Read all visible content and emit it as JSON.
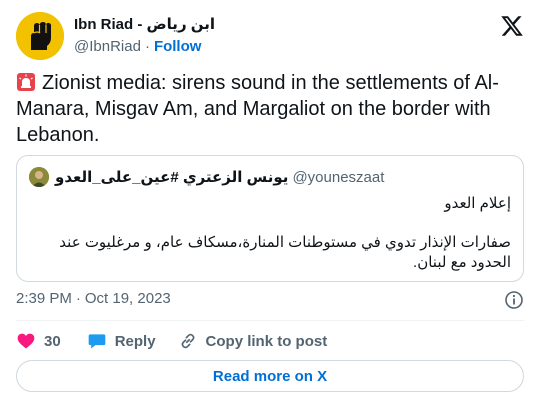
{
  "author": {
    "name": "Ibn Riad - ابن رياض",
    "handle": "@IbnRiad",
    "separator": "·",
    "follow_label": "Follow"
  },
  "tweet": {
    "icon": "rotating-light-icon",
    "text": "Zionist media: sirens sound in the settlements of Al-Manara, Misgav Am, and Margaliot on the border with Lebanon."
  },
  "quote": {
    "name": "يونس الزعتري #عين_على_العدو",
    "handle": "@youneszaat",
    "line1": "إعلام العدو",
    "body": "صفارات الإنذار تدوي في مستوطنات المنارة،مسكاف عام، و مرغليوت عند الحدود مع لبنان."
  },
  "meta": {
    "time": "2:39 PM",
    "separator": "·",
    "date": "Oct 19, 2023"
  },
  "actions": {
    "like_count": "30",
    "reply_label": "Reply",
    "copy_label": "Copy link to post"
  },
  "read_more_label": "Read more on X",
  "colors": {
    "like": "#f91880",
    "reply": "#1d9bf0",
    "link": "#006fd6",
    "muted": "#536471",
    "avatar_bg": "#f2c200"
  }
}
